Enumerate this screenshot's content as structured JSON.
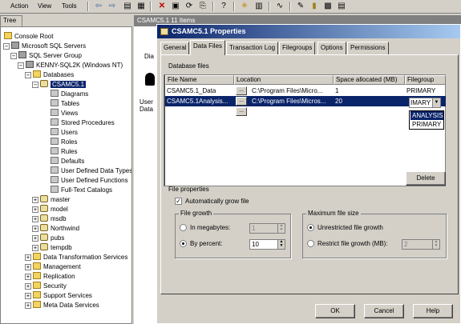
{
  "menubar": {
    "items": [
      "Action",
      "View",
      "Tools"
    ],
    "toolbar_icons": [
      "back-icon",
      "forward-icon",
      "up-icon",
      "show-tree-icon",
      "delete-icon",
      "properties-icon",
      "refresh-icon",
      "export-icon",
      "help-icon",
      "new-server-icon",
      "wizard-icon",
      "edit-icon",
      "database-icon",
      "tables-icon",
      "tools-icon"
    ]
  },
  "tree": {
    "tab_label": "Tree",
    "nodes": [
      {
        "label": "Console Root",
        "level": 0
      },
      {
        "label": "Microsoft SQL Servers",
        "level": 1
      },
      {
        "label": "SQL Server Group",
        "level": 2
      },
      {
        "label": "KENNY-SQL2K (Windows NT)",
        "level": 3
      },
      {
        "label": "Databases",
        "level": 4
      },
      {
        "label": "CSAMC5.1",
        "level": 5
      },
      {
        "label": "Diagrams",
        "level": 6
      },
      {
        "label": "Tables",
        "level": 6
      },
      {
        "label": "Views",
        "level": 6
      },
      {
        "label": "Stored Procedures",
        "level": 6
      },
      {
        "label": "Users",
        "level": 6
      },
      {
        "label": "Roles",
        "level": 6
      },
      {
        "label": "Rules",
        "level": 6
      },
      {
        "label": "Defaults",
        "level": 6
      },
      {
        "label": "User Defined Data Types",
        "level": 6
      },
      {
        "label": "User Defined Functions",
        "level": 6
      },
      {
        "label": "Full-Text Catalogs",
        "level": 6
      },
      {
        "label": "master",
        "level": 5
      },
      {
        "label": "model",
        "level": 5
      },
      {
        "label": "msdb",
        "level": 5
      },
      {
        "label": "Northwind",
        "level": 5
      },
      {
        "label": "pubs",
        "level": 5
      },
      {
        "label": "tempdb",
        "level": 5
      },
      {
        "label": "Data Transformation Services",
        "level": 4
      },
      {
        "label": "Management",
        "level": 4
      },
      {
        "label": "Replication",
        "level": 4
      },
      {
        "label": "Security",
        "level": 4
      },
      {
        "label": "Support Services",
        "level": 4
      },
      {
        "label": "Meta Data Services",
        "level": 4
      }
    ]
  },
  "right_pane": {
    "header": "CSAMC5.1    11 Items",
    "partial_labels": [
      "Dia",
      "User",
      "Data"
    ]
  },
  "dialog": {
    "title": "CSAMC5.1 Properties",
    "tabs": [
      "General",
      "Data Files",
      "Transaction Log",
      "Filegroups",
      "Options",
      "Permissions"
    ],
    "active_tab": "Data Files",
    "section_label": "Database files",
    "columns": [
      "File Name",
      "Location",
      "Space allocated (MB)",
      "Filegroup"
    ],
    "rows": [
      {
        "file_name": "CSAMC5.1_Data",
        "location": "C:\\Program Files\\Micro...",
        "space": "1",
        "filegroup": "PRIMARY"
      },
      {
        "file_name": "CSAMC5.1Analysis...",
        "location": "C:\\Program Files\\Micros...",
        "space": "20",
        "filegroup": "IMARY"
      }
    ],
    "filegroup_options": [
      "ANALYSIS",
      "PRIMARY"
    ],
    "delete_label": "Delete",
    "file_properties_label": "File properties",
    "autogrow_label": "Automatically grow file",
    "file_growth": {
      "title": "File growth",
      "megabytes_label": "In megabytes:",
      "megabytes_value": "1",
      "percent_label": "By percent:",
      "percent_value": "10"
    },
    "max_size": {
      "title": "Maximum file size",
      "unrestricted_label": "Unrestricted file growth",
      "restrict_label": "Restrict file growth (MB):",
      "restrict_value": "2"
    },
    "buttons": {
      "ok": "OK",
      "cancel": "Cancel",
      "help": "Help"
    }
  }
}
